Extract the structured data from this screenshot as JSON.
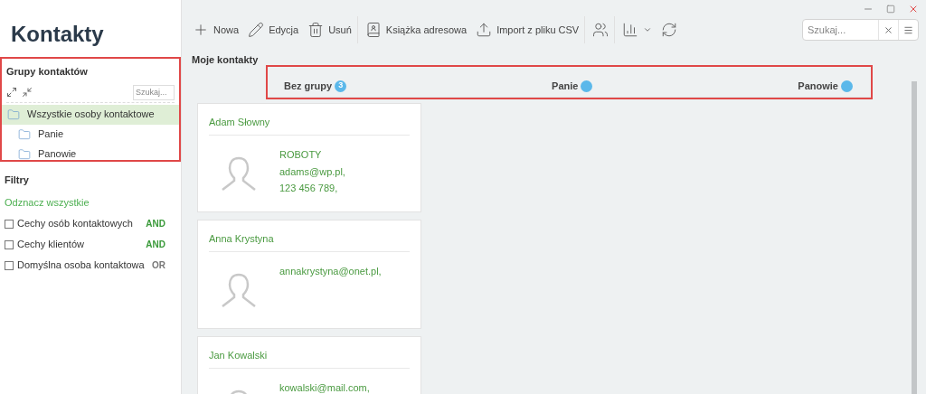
{
  "window": {
    "title": "Kontakty"
  },
  "groups": {
    "title": "Grupy kontaktów",
    "search": {
      "placeholder": "Szukaj..."
    },
    "items": [
      {
        "label": "Wszystkie osoby kontaktowe",
        "selected": true,
        "children": [
          {
            "label": "Panie",
            "selected": false
          },
          {
            "label": "Panowie",
            "selected": false
          }
        ]
      }
    ]
  },
  "filters": {
    "title": "Filtry",
    "select_all": "Odznacz wszystkie",
    "items": [
      {
        "label": "Cechy osób kontaktowych",
        "checked": false,
        "operator": "AND",
        "color": "#3a9a3a"
      },
      {
        "label": "Cechy klientów",
        "checked": false,
        "operator": "AND",
        "color": "#3a9a3a"
      },
      {
        "label": "Domyślna osoba kontaktowa",
        "checked": false,
        "operator": "OR",
        "color": "#777777"
      }
    ]
  },
  "toolbar": [
    {
      "kind": "plus",
      "label": "Nowa"
    },
    {
      "kind": "pencil",
      "label": "Edycja"
    },
    {
      "kind": "trash",
      "label": "Usuń"
    },
    {
      "kind": "book",
      "label": "Książka adresowa"
    },
    {
      "kind": "upload",
      "label": "Import z pliku CSV"
    },
    {
      "kind": "people"
    },
    {
      "kind": "chart"
    },
    {
      "kind": "refresh"
    }
  ],
  "search": {
    "placeholder": "Szukaj..."
  },
  "section_title": "Moje kontakty",
  "columns": [
    {
      "label": "Bez grupy",
      "count": "3"
    },
    {
      "label": "Panie"
    },
    {
      "label": "Panowie"
    }
  ],
  "contacts": [
    {
      "name": "Adam Słowny",
      "lines": [
        "ROBOTY",
        "adams@wp.pl,",
        "123 456 789,"
      ]
    },
    {
      "name": "Anna Krystyna",
      "lines": [
        "annakrystyna@onet.pl,"
      ]
    },
    {
      "name": "Jan Kowalski",
      "lines": [
        "kowalski@mail.com,"
      ]
    }
  ]
}
